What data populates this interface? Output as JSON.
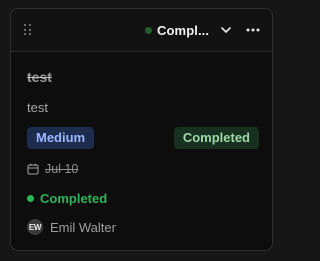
{
  "header": {
    "status_label": "Compl...",
    "status_dot_color": "#1f5e2a",
    "drag_icon": "drag-handle-icon",
    "chevron_icon": "chevron-down-icon",
    "more_icon": "more-horizontal-icon"
  },
  "task": {
    "title": "test",
    "description": "test",
    "priority": "Medium",
    "status_badge": "Completed",
    "due_date": "Jul 10",
    "status_line": "Completed",
    "assignee_initials": "EW",
    "assignee_name": "Emil Walter"
  },
  "colors": {
    "priority_bg": "#1c2c4d",
    "priority_text": "#9bb6ff",
    "completed_bg": "#17301f",
    "completed_text": "#9fd9a8",
    "completed_dot": "#2fb35a"
  }
}
